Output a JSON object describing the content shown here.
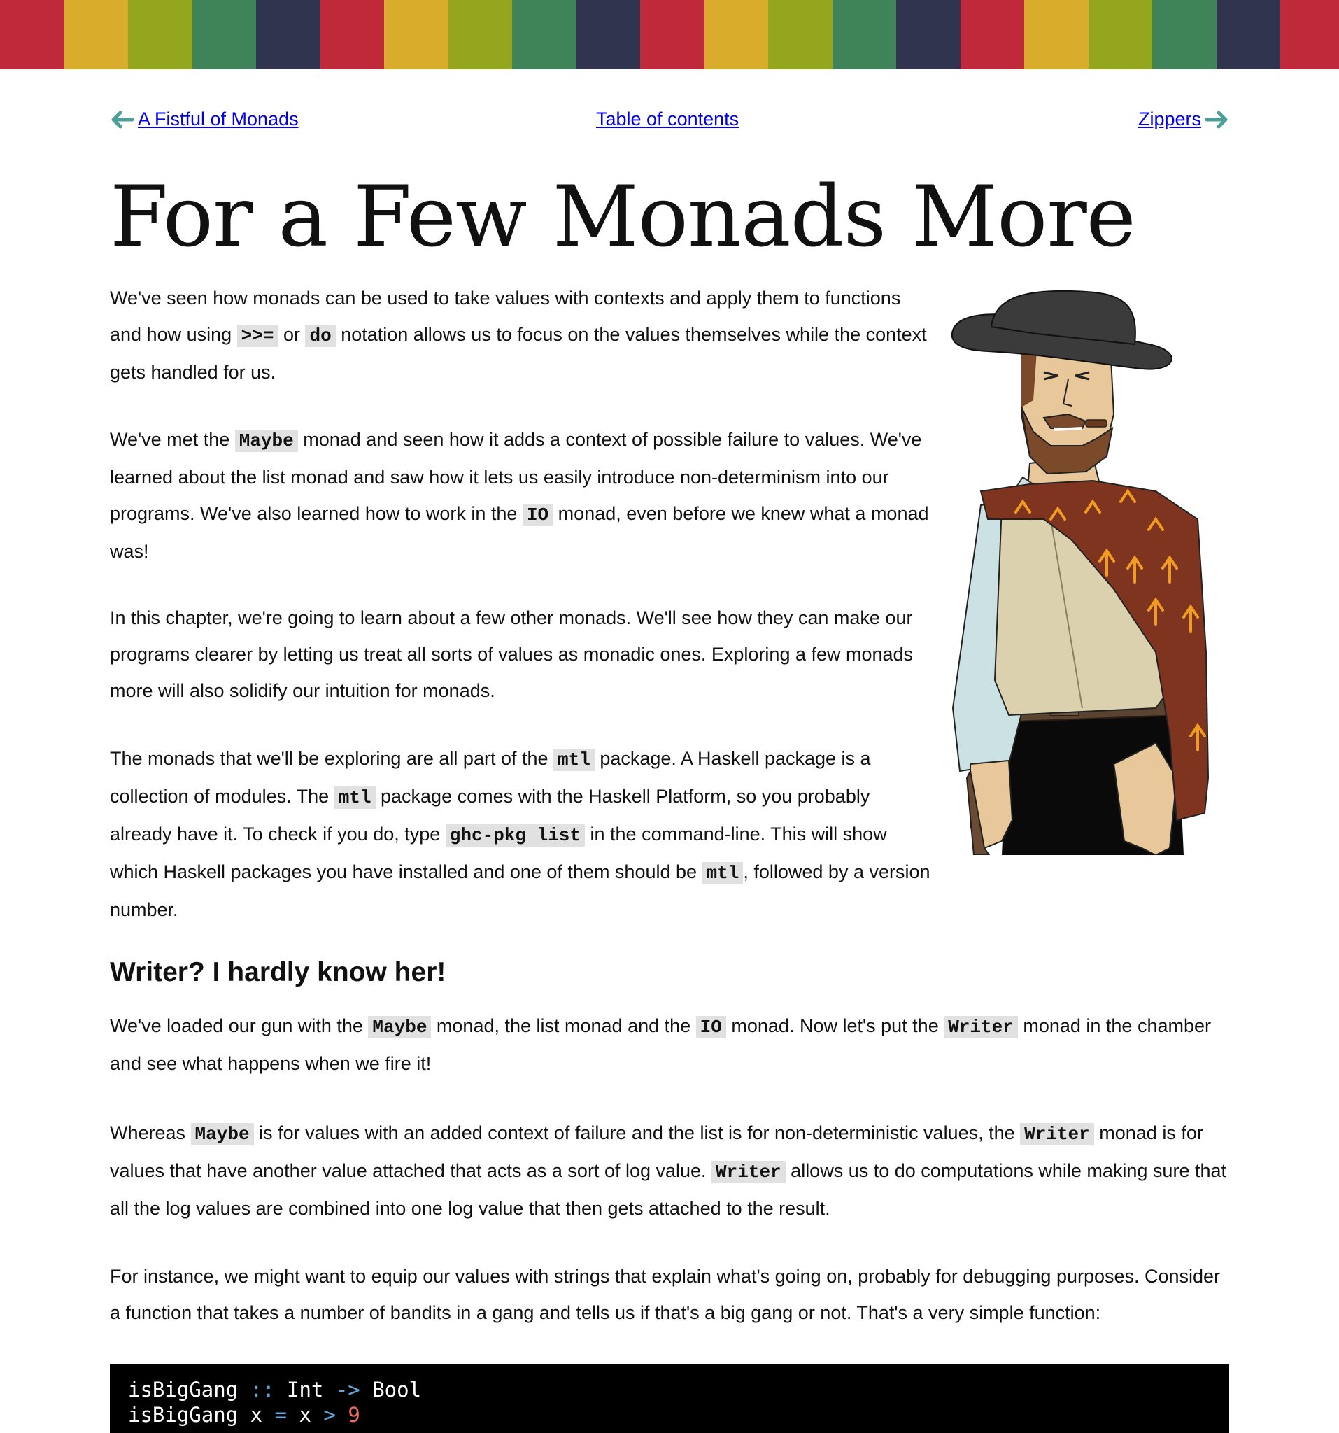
{
  "header": {
    "stripe_colors": [
      "#c0293a",
      "#d9ad2b",
      "#94a51e",
      "#3f8458",
      "#31344f",
      "#c0293a",
      "#d9ad2b",
      "#94a51e",
      "#3f8458",
      "#31344f",
      "#c0293a",
      "#d9ad2b",
      "#94a51e",
      "#3f8458",
      "#31344f",
      "#c0293a",
      "#d9ad2b",
      "#94a51e",
      "#3f8458",
      "#31344f",
      "#c0293a"
    ]
  },
  "nav": {
    "prev_label": "A Fistful of Monads",
    "toc_label": "Table of contents",
    "next_label": "Zippers",
    "arrow_color": "#4a9f98"
  },
  "page": {
    "title": "For a Few Monads More"
  },
  "intro": {
    "p1": {
      "t1": "We've seen how monads can be used to take values with contexts and apply them to functions and how using ",
      "c1": ">>=",
      "t2": " or ",
      "c2": "do",
      "t3": " notation allows us to focus on the values themselves while the context gets handled for us."
    },
    "p2": {
      "t1": "We've met the ",
      "c1": "Maybe",
      "t2": " monad and seen how it adds a context of possible failure to values. We've learned about the list monad and saw how it lets us easily introduce non-determinism into our programs. We've also learned how to work in the ",
      "c2": "IO",
      "t3": " monad, even before we knew what a monad was!"
    },
    "p3": {
      "text": "In this chapter, we're going to learn about a few other monads. We'll see how they can make our programs clearer by letting us treat all sorts of values as monadic ones. Exploring a few monads more will also solidify our intuition for monads."
    },
    "p4": {
      "t1": "The monads that we'll be exploring are all part of the ",
      "c1": "mtl",
      "t2": " package. A Haskell package is a collection of modules. The ",
      "c2": "mtl",
      "t3": " package comes with the Haskell Platform, so you probably already have it. To check if you do, type ",
      "c3": "ghc-pkg list",
      "t4": " in the command-line. This will show which Haskell packages you have installed and one of them should be ",
      "c4": "mtl",
      "t5": ", followed by a version number."
    }
  },
  "section": {
    "heading": "Writer? I hardly know her!",
    "p1": {
      "t1": "We've loaded our gun with the ",
      "c1": "Maybe",
      "t2": " monad, the list monad and the ",
      "c2": "IO",
      "t3": " monad. Now let's put the ",
      "c3": "Writer",
      "t4": " monad in the chamber and see what happens when we fire it!"
    },
    "p2": {
      "t1": "Whereas ",
      "c1": "Maybe",
      "t2": " is for values with an added context of failure and the list is for non-deterministic values, the ",
      "c2": "Writer",
      "t3": " monad is for values that have another value attached that acts as a sort of log value. ",
      "c3": "Writer",
      "t4": " allows us to do computations while making sure that all the log values are combined into one log value that then gets attached to the result."
    },
    "p3": {
      "text": "For instance, we might want to equip our values with strings that explain what's going on, probably for debugging purposes. Consider a function that takes a number of bandits in a gang and tells us if that's a big gang or not. That's a very simple function:"
    }
  },
  "code": {
    "line1": {
      "name": "isBigGang ",
      "op1": "::",
      "sp1": " Int ",
      "op2": "->",
      "sp2": " Bool"
    },
    "line2": {
      "name": "isBigGang x ",
      "op1": "=",
      "sp1": " x ",
      "op2": ">",
      "sp2": " ",
      "num": "9"
    }
  }
}
